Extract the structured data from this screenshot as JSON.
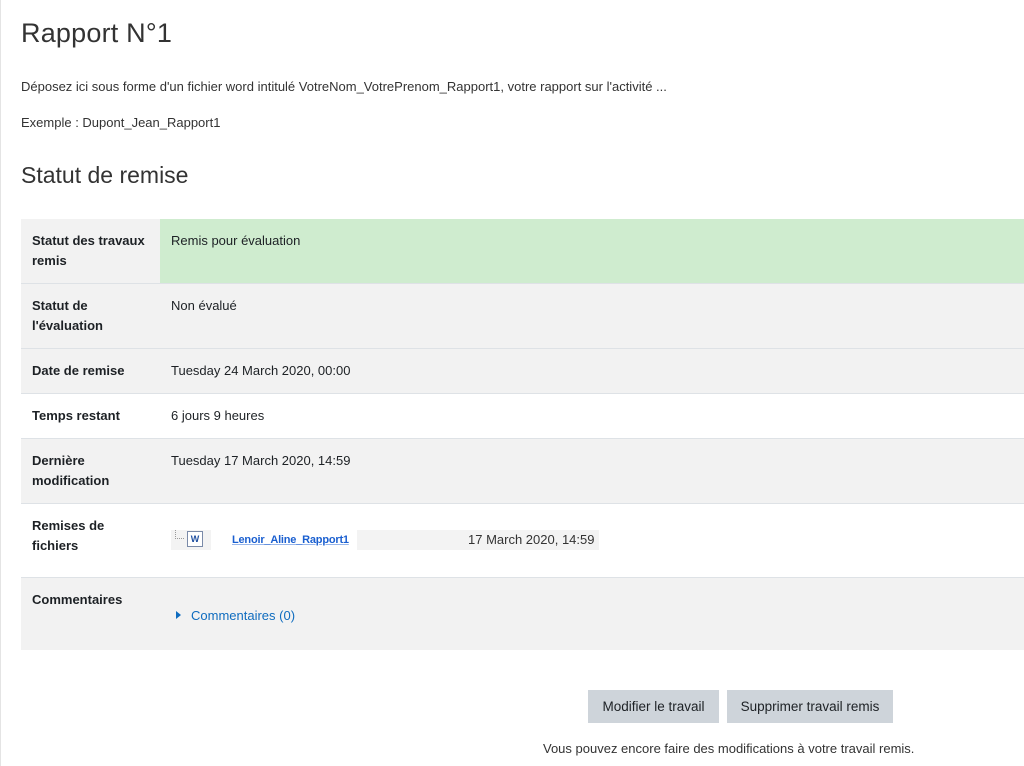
{
  "page": {
    "title": "Rapport N°1",
    "intro_line1": "Déposez ici sous forme d'un fichier word intitulé VotreNom_VotrePrenom_Rapport1, votre rapport sur l'activité ...",
    "intro_line2": "Exemple : Dupont_Jean_Rapport1"
  },
  "submission": {
    "section_title": "Statut de remise",
    "rows": [
      {
        "label": "Statut des travaux remis",
        "value": "Remis pour évaluation"
      },
      {
        "label": "Statut de l'évaluation",
        "value": "Non évalué"
      },
      {
        "label": "Date de remise",
        "value": "Tuesday 24 March 2020, 00:00"
      },
      {
        "label": "Temps restant",
        "value": "6 jours 9 heures"
      },
      {
        "label": "Dernière modification",
        "value": "Tuesday 17 March 2020, 14:59"
      },
      {
        "label": "Remises de fichiers",
        "value": ""
      },
      {
        "label": "Commentaires",
        "value": ""
      }
    ],
    "file": {
      "icon": "word-file-icon",
      "icon_text": "W",
      "name": "Lenoir_Aline_Rapport1",
      "date": "17 March 2020, 14:59"
    },
    "comments_link": "Commentaires (0)",
    "colors": {
      "submitted_bg": "#cfeccf",
      "link": "#0f6cbf"
    }
  },
  "actions": {
    "edit_label": "Modifier le travail",
    "remove_label": "Supprimer travail remis",
    "hint": "Vous pouvez encore faire des modifications à votre travail remis."
  }
}
